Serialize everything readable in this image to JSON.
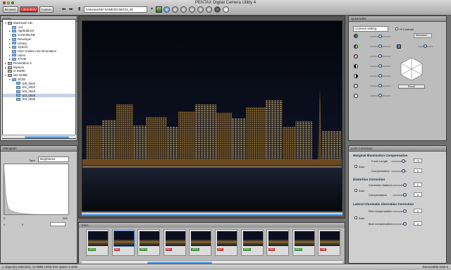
{
  "window": {
    "title": "PENTAX Digital Camera Utility 4"
  },
  "modes": [
    {
      "label": "Browser"
    },
    {
      "label": "Laboratory"
    },
    {
      "label": "Custom"
    }
  ],
  "path": {
    "value": "/Volumes/NO NAME/DCIM/103_09"
  },
  "tree": {
    "title": "Folder",
    "items": [
      {
        "label": "Macintosh HD",
        "indent": 1,
        "kind": "disk",
        "open": true
      },
      {
        "label": ".vol",
        "indent": 2,
        "kind": "folder"
      },
      {
        "label": "Applications",
        "indent": 2,
        "kind": "folder",
        "exp": true
      },
      {
        "label": "ControllerDB",
        "indent": 2,
        "kind": "folder"
      },
      {
        "label": "Developer",
        "indent": 2,
        "kind": "folder",
        "exp": true
      },
      {
        "label": "Library",
        "indent": 2,
        "kind": "folder",
        "exp": true
      },
      {
        "label": "System",
        "indent": 2,
        "kind": "folder",
        "exp": true
      },
      {
        "label": "User Guides And Information",
        "indent": 2,
        "kind": "folder"
      },
      {
        "label": "Users",
        "indent": 2,
        "kind": "folder",
        "exp": true
      },
      {
        "label": "XTUM",
        "indent": 2,
        "kind": "folder",
        "exp": true
      },
      {
        "label": "Restoration X",
        "indent": 1,
        "kind": "disk",
        "exp": true
      },
      {
        "label": "Elysium",
        "indent": 1,
        "kind": "disk",
        "exp": true
      },
      {
        "label": "G-SW90",
        "indent": 1,
        "kind": "disk"
      },
      {
        "label": "NO NAME",
        "indent": 1,
        "kind": "disk",
        "open": true
      },
      {
        "label": "DCIM",
        "indent": 2,
        "kind": "folder",
        "open": true
      },
      {
        "label": "100_0920",
        "indent": 3,
        "kind": "folder"
      },
      {
        "label": "101_0922",
        "indent": 3,
        "kind": "folder"
      },
      {
        "label": "102_0923",
        "indent": 3,
        "kind": "folder"
      },
      {
        "label": "103_0925",
        "indent": 3,
        "kind": "folder",
        "selected": true
      },
      {
        "label": "104_0926",
        "indent": 3,
        "kind": "folder"
      }
    ]
  },
  "histogram": {
    "title": "Histogram",
    "type_label": "Type",
    "type_value": "Brightness",
    "min": "0",
    "max": "255",
    "row2": [
      "0",
      "0"
    ]
  },
  "right_top": {
    "tab": "Quick Edits",
    "setting": "Camera setting",
    "contrast_label": "Hi Contrast",
    "dropdown": "Monotone",
    "reset": "Reset"
  },
  "lens": {
    "header": "Lens Correction",
    "marginal": {
      "title": "Marginal Illumination Compensation",
      "auto": "Auto",
      "focal": "Focal Length",
      "focal_val": "75",
      "comp": "Compensation",
      "comp_val": "0"
    },
    "distortion": {
      "title": "Distortion Correction",
      "auto": "Auto",
      "balance": "Correction balance",
      "balance_val": "0",
      "comp": "Compensation",
      "comp_val": "0"
    },
    "lateral": {
      "title": "Lateral Chromatic Aberration Correction",
      "auto": "Auto",
      "red": "Red compensation",
      "red_val": "0",
      "blue": "Blue compensation",
      "blue_val": "0"
    }
  },
  "filmstrip": {
    "title": "JPEG",
    "items": [
      {
        "badge": "JPEG",
        "color": "#2d8a2d"
      },
      {
        "badge": "PEF",
        "color": "#c03030"
      },
      {
        "badge": "JPEG",
        "color": "#2d8a2d"
      },
      {
        "badge": "PEF",
        "color": "#c03030"
      },
      {
        "badge": "JPEG",
        "color": "#2d8a2d"
      },
      {
        "badge": "PEF",
        "color": "#c03030"
      },
      {
        "badge": "JPEG",
        "color": "#2d8a2d"
      },
      {
        "badge": "PEF",
        "color": "#c03030"
      },
      {
        "badge": "JPEG",
        "color": "#2d8a2d"
      },
      {
        "badge": "PEF",
        "color": "#c03030"
      }
    ]
  },
  "status": {
    "left": "1 object(s) selected | 12.0MB | Disk free space 4.4GB",
    "right": "Removable Disk 5"
  },
  "colors": {
    "accent": "#2f7fd6",
    "active_mode": "#c81a1a"
  }
}
